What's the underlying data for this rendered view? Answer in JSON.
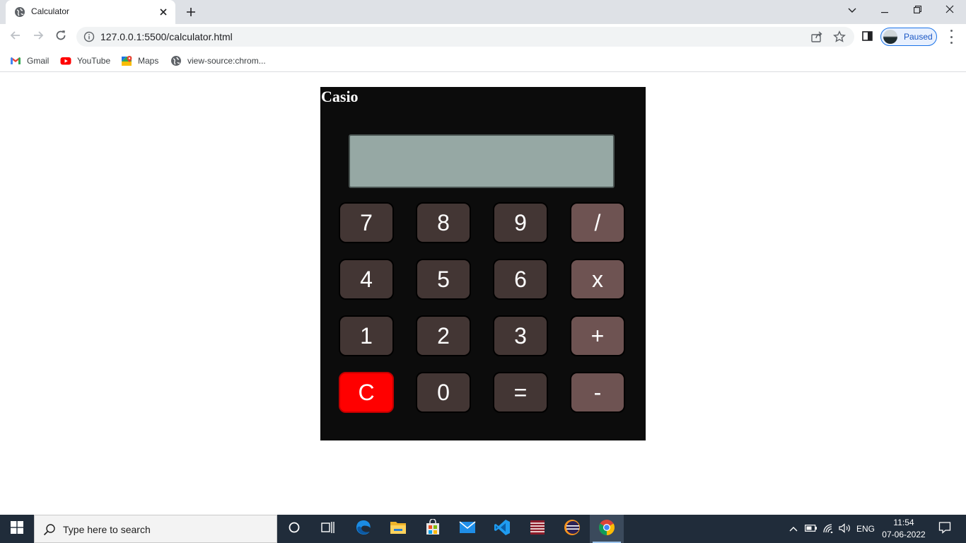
{
  "browser": {
    "tab": {
      "title": "Calculator"
    },
    "url": "127.0.0.1:5500/calculator.html",
    "profile_label": "Paused",
    "bookmarks": [
      {
        "label": "Gmail",
        "icon": "gmail-icon"
      },
      {
        "label": "YouTube",
        "icon": "youtube-icon"
      },
      {
        "label": "Maps",
        "icon": "maps-icon"
      },
      {
        "label": "view-source:chrom...",
        "icon": "globe-icon"
      }
    ]
  },
  "calculator": {
    "brand": "Casio",
    "display_value": "",
    "keys": [
      {
        "label": "7",
        "kind": "digit"
      },
      {
        "label": "8",
        "kind": "digit"
      },
      {
        "label": "9",
        "kind": "digit"
      },
      {
        "label": "/",
        "kind": "op"
      },
      {
        "label": "4",
        "kind": "digit"
      },
      {
        "label": "5",
        "kind": "digit"
      },
      {
        "label": "6",
        "kind": "digit"
      },
      {
        "label": "x",
        "kind": "op"
      },
      {
        "label": "1",
        "kind": "digit"
      },
      {
        "label": "2",
        "kind": "digit"
      },
      {
        "label": "3",
        "kind": "digit"
      },
      {
        "label": "+",
        "kind": "op"
      },
      {
        "label": "C",
        "kind": "clear"
      },
      {
        "label": "0",
        "kind": "digit"
      },
      {
        "label": "=",
        "kind": "equals"
      },
      {
        "label": "-",
        "kind": "op"
      }
    ],
    "colors": {
      "body": "#0c0c0c",
      "display": "#96a8a4",
      "digit_key": "#433634",
      "operator_key": "#6e5352",
      "clear_key": "#ff0000"
    }
  },
  "taskbar": {
    "search_placeholder": "Type here to search",
    "language": "ENG",
    "time": "11:54",
    "date": "07-06-2022"
  }
}
